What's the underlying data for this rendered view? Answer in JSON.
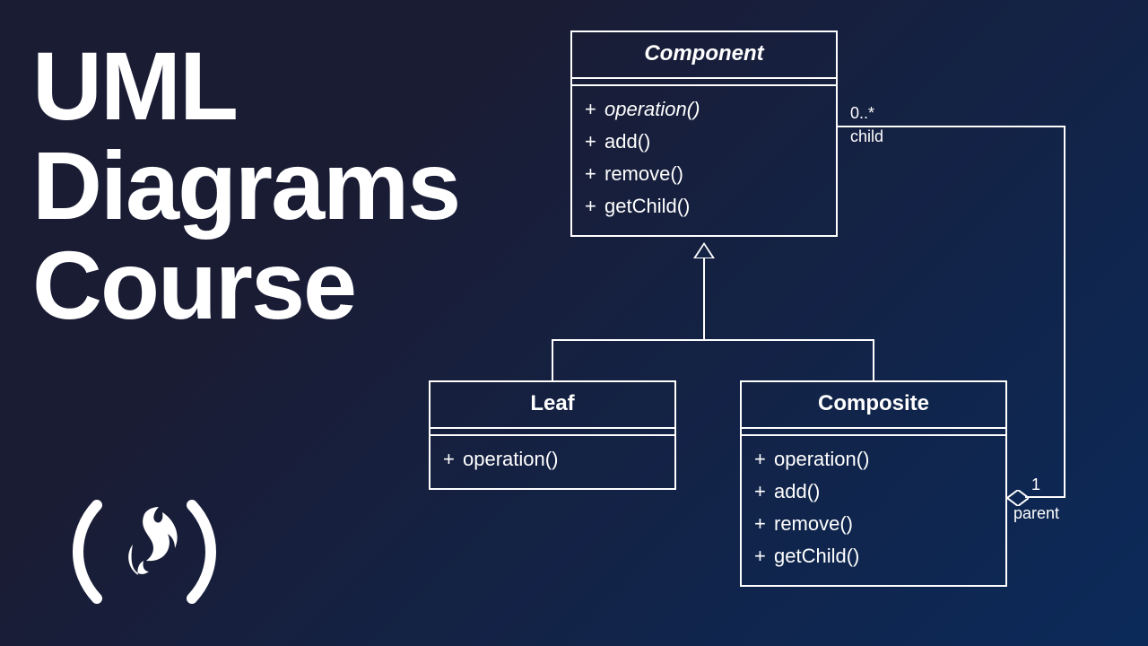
{
  "title": {
    "line1": "UML",
    "line2": "Diagrams",
    "line3": "Course"
  },
  "classes": {
    "component": {
      "name": "Component",
      "abstract": true,
      "ops": [
        {
          "vis": "+",
          "sig": "operation()",
          "abstract": true
        },
        {
          "vis": "+",
          "sig": "add()"
        },
        {
          "vis": "+",
          "sig": "remove()"
        },
        {
          "vis": "+",
          "sig": "getChild()"
        }
      ]
    },
    "leaf": {
      "name": "Leaf",
      "ops": [
        {
          "vis": "+",
          "sig": "operation()"
        }
      ]
    },
    "composite": {
      "name": "Composite",
      "ops": [
        {
          "vis": "+",
          "sig": "operation()"
        },
        {
          "vis": "+",
          "sig": "add()"
        },
        {
          "vis": "+",
          "sig": "remove()"
        },
        {
          "vis": "+",
          "sig": "getChild()"
        }
      ]
    }
  },
  "associations": {
    "child": {
      "mult": "0..*",
      "role": "child"
    },
    "parent": {
      "mult": "1",
      "role": "parent"
    }
  }
}
